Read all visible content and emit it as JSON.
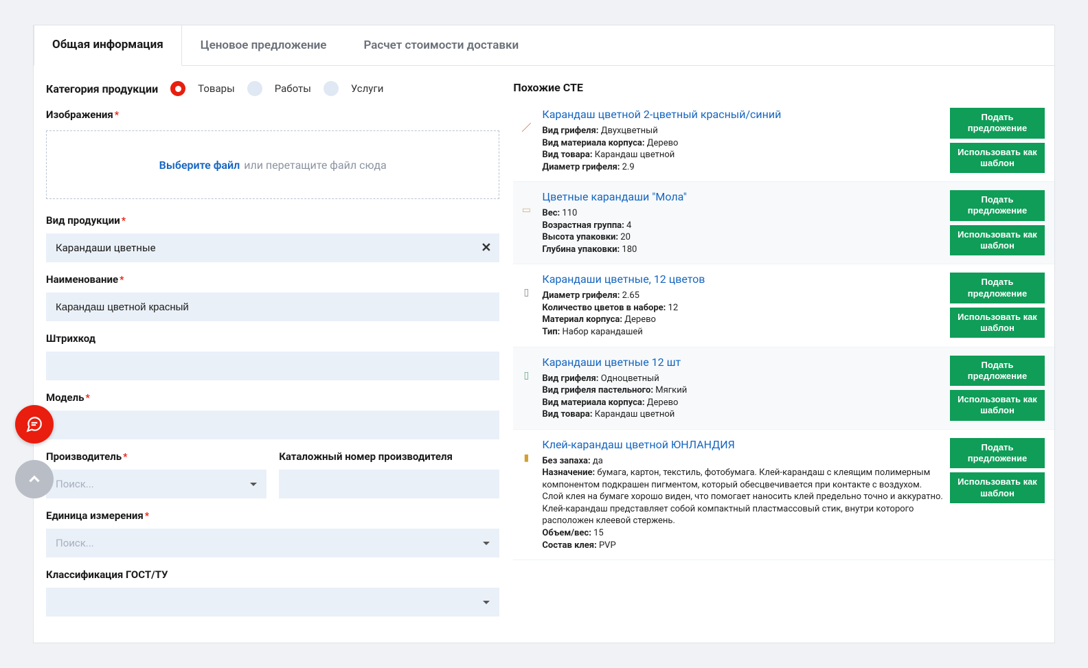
{
  "tabs": {
    "general": "Общая информация",
    "price": "Ценовое предложение",
    "shipping": "Расчет стоимости доставки"
  },
  "category": {
    "label": "Категория продукции",
    "options": {
      "goods": "Товары",
      "works": "Работы",
      "services": "Услуги"
    }
  },
  "images": {
    "label": "Изображения",
    "choose": "Выберите файл",
    "hint": "или перетащите файл сюда"
  },
  "product_type": {
    "label": "Вид продукции",
    "value": "Карандаши цветные"
  },
  "name": {
    "label": "Наименование",
    "value": "Карандаш цветной красный"
  },
  "barcode": {
    "label": "Штрихкод"
  },
  "model": {
    "label": "Модель"
  },
  "manufacturer": {
    "label": "Производитель",
    "placeholder": "Поиск...",
    "catalog_num": "Каталожный номер производителя"
  },
  "unit": {
    "label": "Единица измерения",
    "placeholder": "Поиск..."
  },
  "gost": {
    "label": "Классификация ГОСТ/ТУ"
  },
  "similar": {
    "header": "Похожие СТЕ",
    "submit_btn": "Подать предложение",
    "template_btn": "Использовать как шаблон",
    "items": [
      {
        "title": "Карандаш цветной 2-цветный красный/синий",
        "attrs": [
          "Вид грифеля: Двухцветный",
          "Вид материала корпуса: Дерево",
          "Вид товара: Карандаш цветной",
          "Диаметр грифеля: 2.9"
        ]
      },
      {
        "title": "Цветные карандаши \"Мола\"",
        "attrs": [
          "Вес: 110",
          "Возрастная группа: 4",
          "Высота упаковки: 20",
          "Глубина упаковки: 180"
        ]
      },
      {
        "title": "Карандаши цветные, 12 цветов",
        "attrs": [
          "Диаметр грифеля: 2.65",
          "Количество цветов в наборе: 12",
          "Материал корпуса: Дерево",
          "Тип: Набор карандашей"
        ]
      },
      {
        "title": "Карандаши цветные 12 шт",
        "attrs": [
          "Вид грифеля: Одноцветный",
          "Вид грифеля пастельного: Мягкий",
          "Вид материала корпуса: Дерево",
          "Вид товара: Карандаш цветной"
        ]
      },
      {
        "title": "Клей-карандаш цветной ЮНЛАНДИЯ",
        "attrs": [
          "Без запаха: да",
          "Назначение: бумага, картон, текстиль, фотобумага. Клей-карандаш с клеящим полимерным компонентом подкрашен пигментом, который обесцвечивается при контакте с воздухом. Слой клея на бумаге хорошо виден, что помогает наносить клей предельно точно и аккуратно. Клей-карандаш представляет собой компактный пластмассовый стик, внутри которого расположен клеевой стержень.",
          "Объем/вес: 15",
          "Состав клея: PVP"
        ]
      }
    ]
  }
}
